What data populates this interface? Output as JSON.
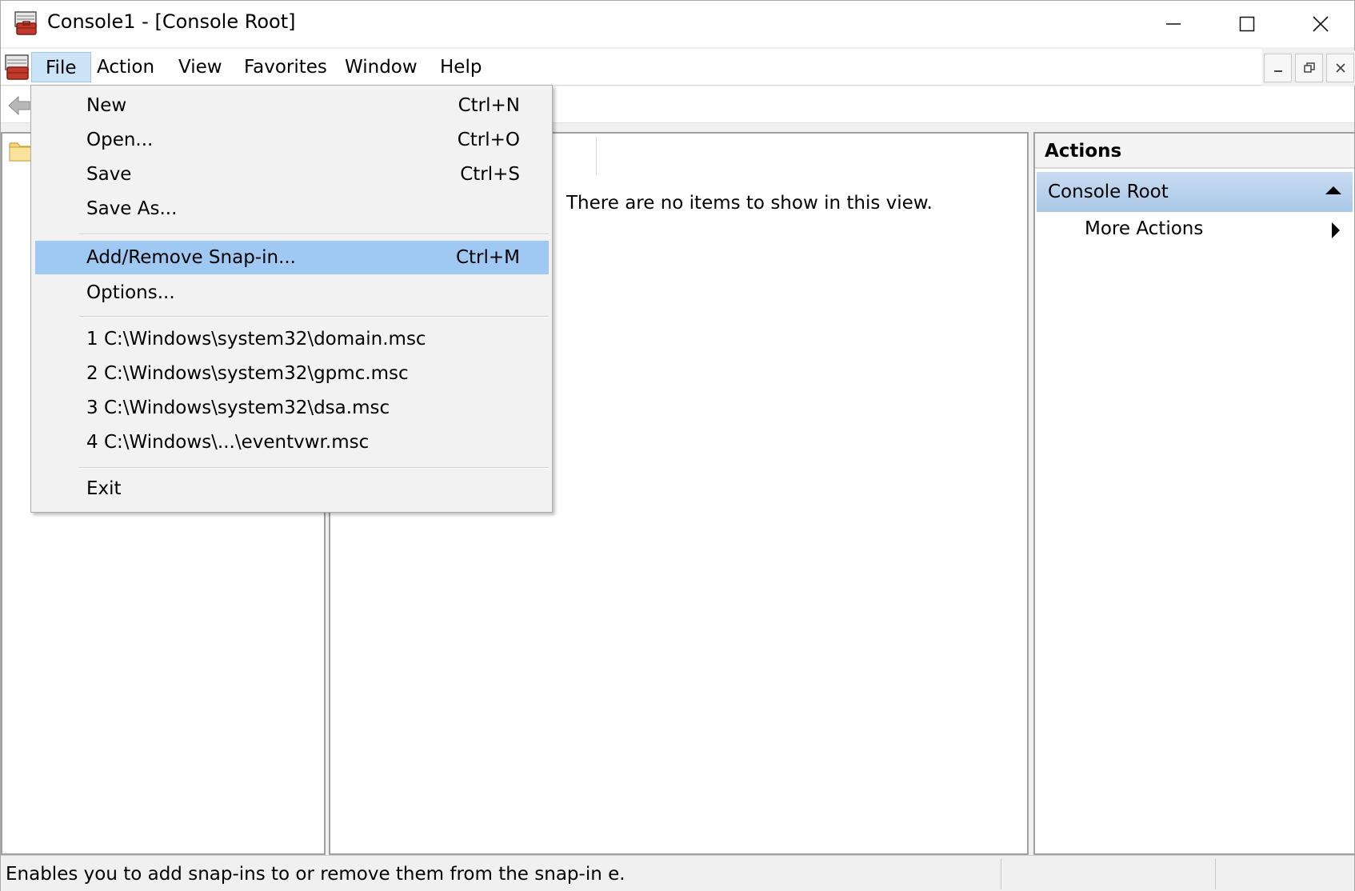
{
  "window": {
    "title": "Console1 - [Console Root]",
    "controls": {
      "minimize": "—",
      "maximize": "☐",
      "close": "✕"
    }
  },
  "menubar": {
    "items": [
      "File",
      "Action",
      "View",
      "Favorites",
      "Window",
      "Help"
    ],
    "active": "File"
  },
  "file_menu": {
    "items": [
      {
        "label": "New",
        "shortcut": "Ctrl+N"
      },
      {
        "label": "Open...",
        "shortcut": "Ctrl+O"
      },
      {
        "label": "Save",
        "shortcut": "Ctrl+S"
      },
      {
        "label": "Save As...",
        "shortcut": ""
      },
      {
        "label": "Add/Remove Snap-in...",
        "shortcut": "Ctrl+M",
        "highlighted": true
      },
      {
        "label": "Options...",
        "shortcut": ""
      },
      {
        "label": "1 C:\\Windows\\system32\\domain.msc",
        "shortcut": ""
      },
      {
        "label": "2 C:\\Windows\\system32\\gpmc.msc",
        "shortcut": ""
      },
      {
        "label": "3 C:\\Windows\\system32\\dsa.msc",
        "shortcut": ""
      },
      {
        "label": "4 C:\\Windows\\...\\eventvwr.msc",
        "shortcut": ""
      },
      {
        "label": "Exit",
        "shortcut": ""
      }
    ]
  },
  "result_pane": {
    "empty_message": "There are no items to show in this view."
  },
  "actions_pane": {
    "header": "Actions",
    "section": "Console Root",
    "items": [
      "More Actions"
    ]
  },
  "statusbar": {
    "text": "Enables you to add snap-ins to or remove them from the snap-in e."
  },
  "colors": {
    "menu_highlight": "#9fc9f3",
    "menubar_active": "#cce4f7",
    "actions_section": "#aac7e8"
  },
  "icons": {
    "app": "mmc-toolbox-icon",
    "back": "back-arrow-icon",
    "folder": "folder-icon"
  }
}
